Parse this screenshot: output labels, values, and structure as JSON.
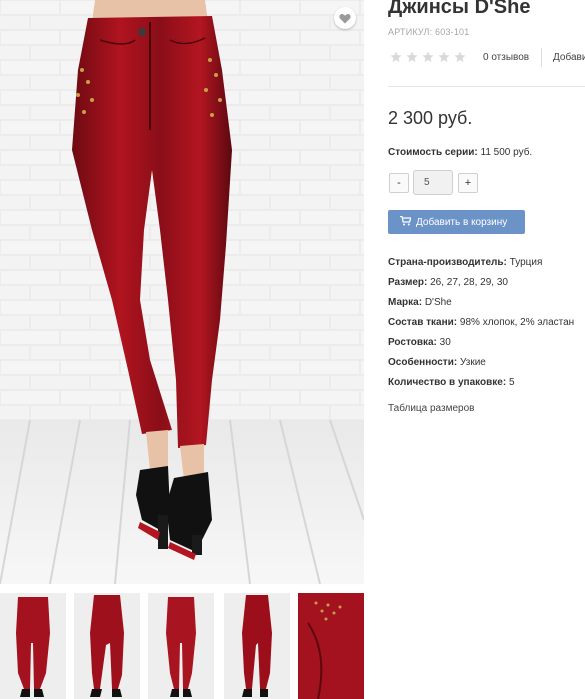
{
  "product": {
    "title": "Джинсы D'She",
    "sku": "АРТИКУЛ: 603-101",
    "reviews_label": "0 отзывов",
    "add_review_label": "Добавить отзыв",
    "rating": 0,
    "rating_max": 5,
    "price": "2 300 руб.",
    "series_label": "Стоимость серии:",
    "series_value": "11 500 руб."
  },
  "quantity": {
    "minus_label": "-",
    "value": "5",
    "plus_label": "+"
  },
  "cart": {
    "button_label": "Добавить в корзину",
    "icon": "cart-icon"
  },
  "specs": [
    {
      "label": "Страна-производитель:",
      "value": "Турция"
    },
    {
      "label": "Размер:",
      "value": "26, 27, 28, 29, 30"
    },
    {
      "label": "Марка:",
      "value": "D'She"
    },
    {
      "label": "Состав ткани:",
      "value": "98% хлопок, 2% эластан"
    },
    {
      "label": "Ростовка:",
      "value": "30"
    },
    {
      "label": "Особенности:",
      "value": "Узкие"
    },
    {
      "label": "Количество в упаковке:",
      "value": "5"
    }
  ],
  "size_table_link": "Таблица размеров",
  "icons": {
    "wishlist": "heart-icon",
    "star": "star-icon"
  },
  "colors": {
    "accent": "#6c93c8",
    "jeans": "#a3121e",
    "star_empty": "#d9d9d9"
  }
}
